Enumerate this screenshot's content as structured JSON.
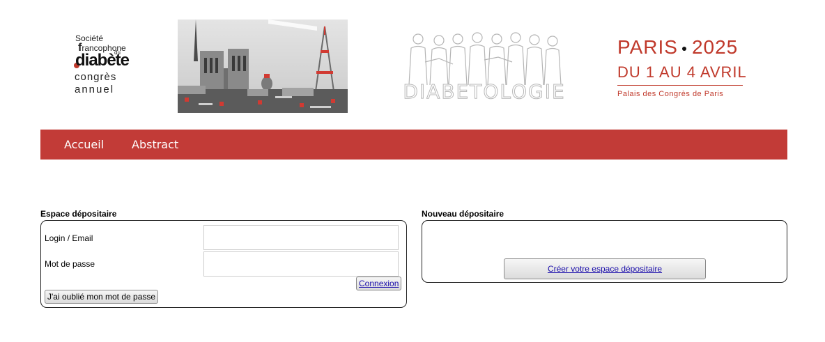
{
  "header": {
    "sfd_logo": {
      "line1": "Société",
      "line2_initial": "f",
      "line2_rest": "rancophone",
      "line3": "du",
      "line4": "diabète",
      "line5": "congrès",
      "line6": "annuel"
    },
    "diabetologie_text": "DIABETOLOGIE",
    "event": {
      "city": "PARIS",
      "year": "2025",
      "dates": "DU 1 AU 4 AVRIL",
      "venue": "Palais des Congrès de Paris"
    }
  },
  "nav": {
    "items": [
      {
        "label": "Accueil"
      },
      {
        "label": "Abstract"
      }
    ]
  },
  "login_panel": {
    "title": "Espace dépositaire",
    "login_label": "Login / Email",
    "login_value": "",
    "password_label": "Mot de passe",
    "password_value": "",
    "connect_button": "Connexion",
    "forgot_button": "J'ai oublié mon mot de passe"
  },
  "new_panel": {
    "title": "Nouveau dépositaire",
    "create_button": "Créer votre espace dépositaire"
  },
  "colors": {
    "brand_red": "#c23b37",
    "border": "#222222",
    "link": "#1a0dab"
  }
}
